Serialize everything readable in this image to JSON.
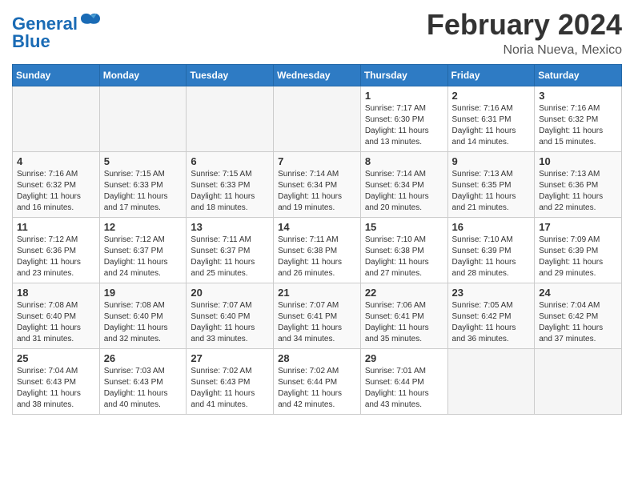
{
  "header": {
    "logo_general": "General",
    "logo_blue": "Blue",
    "title": "February 2024",
    "subtitle": "Noria Nueva, Mexico"
  },
  "weekdays": [
    "Sunday",
    "Monday",
    "Tuesday",
    "Wednesday",
    "Thursday",
    "Friday",
    "Saturday"
  ],
  "weeks": [
    [
      {
        "day": "",
        "sunrise": "",
        "sunset": "",
        "daylight": ""
      },
      {
        "day": "",
        "sunrise": "",
        "sunset": "",
        "daylight": ""
      },
      {
        "day": "",
        "sunrise": "",
        "sunset": "",
        "daylight": ""
      },
      {
        "day": "",
        "sunrise": "",
        "sunset": "",
        "daylight": ""
      },
      {
        "day": "1",
        "sunrise": "7:17 AM",
        "sunset": "6:30 PM",
        "daylight": "11 hours and 13 minutes."
      },
      {
        "day": "2",
        "sunrise": "7:16 AM",
        "sunset": "6:31 PM",
        "daylight": "11 hours and 14 minutes."
      },
      {
        "day": "3",
        "sunrise": "7:16 AM",
        "sunset": "6:32 PM",
        "daylight": "11 hours and 15 minutes."
      }
    ],
    [
      {
        "day": "4",
        "sunrise": "7:16 AM",
        "sunset": "6:32 PM",
        "daylight": "11 hours and 16 minutes."
      },
      {
        "day": "5",
        "sunrise": "7:15 AM",
        "sunset": "6:33 PM",
        "daylight": "11 hours and 17 minutes."
      },
      {
        "day": "6",
        "sunrise": "7:15 AM",
        "sunset": "6:33 PM",
        "daylight": "11 hours and 18 minutes."
      },
      {
        "day": "7",
        "sunrise": "7:14 AM",
        "sunset": "6:34 PM",
        "daylight": "11 hours and 19 minutes."
      },
      {
        "day": "8",
        "sunrise": "7:14 AM",
        "sunset": "6:34 PM",
        "daylight": "11 hours and 20 minutes."
      },
      {
        "day": "9",
        "sunrise": "7:13 AM",
        "sunset": "6:35 PM",
        "daylight": "11 hours and 21 minutes."
      },
      {
        "day": "10",
        "sunrise": "7:13 AM",
        "sunset": "6:36 PM",
        "daylight": "11 hours and 22 minutes."
      }
    ],
    [
      {
        "day": "11",
        "sunrise": "7:12 AM",
        "sunset": "6:36 PM",
        "daylight": "11 hours and 23 minutes."
      },
      {
        "day": "12",
        "sunrise": "7:12 AM",
        "sunset": "6:37 PM",
        "daylight": "11 hours and 24 minutes."
      },
      {
        "day": "13",
        "sunrise": "7:11 AM",
        "sunset": "6:37 PM",
        "daylight": "11 hours and 25 minutes."
      },
      {
        "day": "14",
        "sunrise": "7:11 AM",
        "sunset": "6:38 PM",
        "daylight": "11 hours and 26 minutes."
      },
      {
        "day": "15",
        "sunrise": "7:10 AM",
        "sunset": "6:38 PM",
        "daylight": "11 hours and 27 minutes."
      },
      {
        "day": "16",
        "sunrise": "7:10 AM",
        "sunset": "6:39 PM",
        "daylight": "11 hours and 28 minutes."
      },
      {
        "day": "17",
        "sunrise": "7:09 AM",
        "sunset": "6:39 PM",
        "daylight": "11 hours and 29 minutes."
      }
    ],
    [
      {
        "day": "18",
        "sunrise": "7:08 AM",
        "sunset": "6:40 PM",
        "daylight": "11 hours and 31 minutes."
      },
      {
        "day": "19",
        "sunrise": "7:08 AM",
        "sunset": "6:40 PM",
        "daylight": "11 hours and 32 minutes."
      },
      {
        "day": "20",
        "sunrise": "7:07 AM",
        "sunset": "6:40 PM",
        "daylight": "11 hours and 33 minutes."
      },
      {
        "day": "21",
        "sunrise": "7:07 AM",
        "sunset": "6:41 PM",
        "daylight": "11 hours and 34 minutes."
      },
      {
        "day": "22",
        "sunrise": "7:06 AM",
        "sunset": "6:41 PM",
        "daylight": "11 hours and 35 minutes."
      },
      {
        "day": "23",
        "sunrise": "7:05 AM",
        "sunset": "6:42 PM",
        "daylight": "11 hours and 36 minutes."
      },
      {
        "day": "24",
        "sunrise": "7:04 AM",
        "sunset": "6:42 PM",
        "daylight": "11 hours and 37 minutes."
      }
    ],
    [
      {
        "day": "25",
        "sunrise": "7:04 AM",
        "sunset": "6:43 PM",
        "daylight": "11 hours and 38 minutes."
      },
      {
        "day": "26",
        "sunrise": "7:03 AM",
        "sunset": "6:43 PM",
        "daylight": "11 hours and 40 minutes."
      },
      {
        "day": "27",
        "sunrise": "7:02 AM",
        "sunset": "6:43 PM",
        "daylight": "11 hours and 41 minutes."
      },
      {
        "day": "28",
        "sunrise": "7:02 AM",
        "sunset": "6:44 PM",
        "daylight": "11 hours and 42 minutes."
      },
      {
        "day": "29",
        "sunrise": "7:01 AM",
        "sunset": "6:44 PM",
        "daylight": "11 hours and 43 minutes."
      },
      {
        "day": "",
        "sunrise": "",
        "sunset": "",
        "daylight": ""
      },
      {
        "day": "",
        "sunrise": "",
        "sunset": "",
        "daylight": ""
      }
    ]
  ]
}
